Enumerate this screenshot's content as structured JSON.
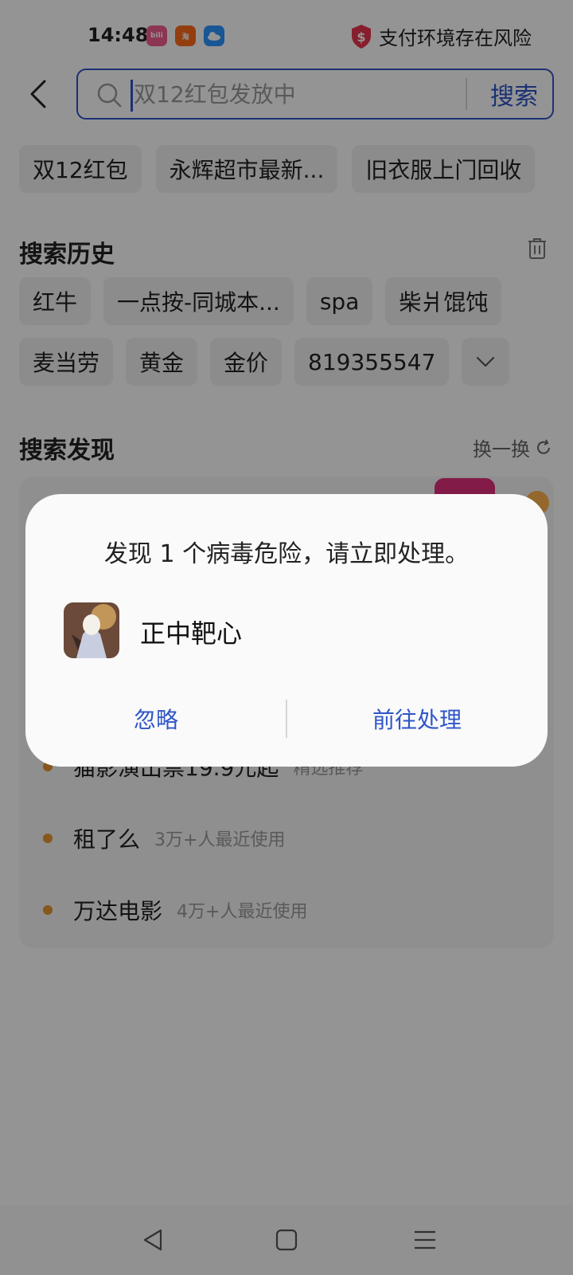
{
  "status_bar": {
    "time": "14:48",
    "app_icons": [
      "bilibili-icon",
      "taobao-icon",
      "weather-icon"
    ],
    "risk_text": "支付环境存在风险"
  },
  "search": {
    "placeholder": "双12红包发放中",
    "button_label": "搜索"
  },
  "suggestion_chips": [
    "双12红包",
    "永辉超市最新...",
    "旧衣服上门回收"
  ],
  "history": {
    "title": "搜索历史",
    "row1": [
      "红牛",
      "一点按-同城本...",
      "spa",
      "柴爿馄饨"
    ],
    "row2": [
      "麦当劳",
      "黄金",
      "金价",
      "819355547"
    ]
  },
  "discover": {
    "title": "搜索发现",
    "refresh_label": "换一换",
    "items": [
      {
        "name": "猫影演出票19.9元起",
        "meta": "精选推荐"
      },
      {
        "name": "租了么",
        "meta": "3万+人最近使用"
      },
      {
        "name": "万达电影",
        "meta": "4万+人最近使用"
      }
    ]
  },
  "dialog": {
    "title": "发现 1 个病毒危险，请立即处理。",
    "app_name": "正中靶心",
    "ignore_label": "忽略",
    "go_label": "前往处理"
  },
  "colors": {
    "accent": "#2f55c8",
    "dot": "#e8962f",
    "risk_shield": "#e8354f"
  }
}
